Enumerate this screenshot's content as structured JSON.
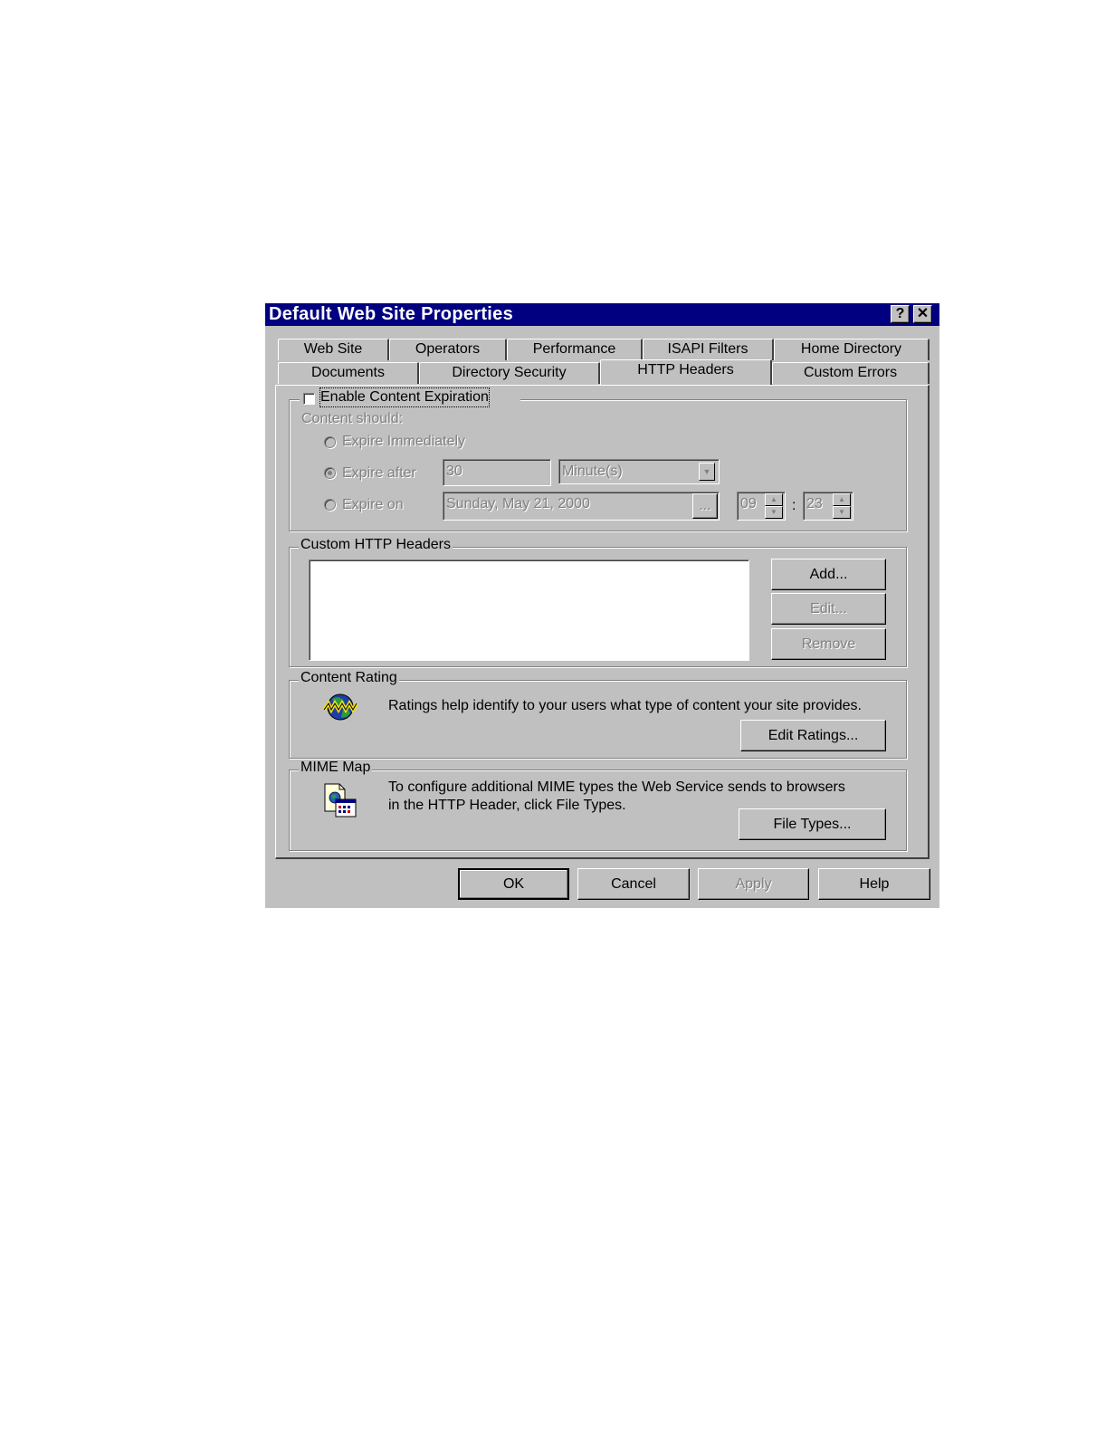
{
  "window": {
    "title": "Default Web Site Properties",
    "help_glyph": "?",
    "close_glyph": "✕"
  },
  "tabs": {
    "row1": [
      "Web Site",
      "Operators",
      "Performance",
      "ISAPI Filters",
      "Home Directory"
    ],
    "row2": [
      "Documents",
      "Directory Security",
      "HTTP Headers",
      "Custom Errors"
    ],
    "active": "HTTP Headers"
  },
  "expiration": {
    "enable_label": "Enable Content Expiration",
    "content_should": "Content should:",
    "expire_immediately": "Expire Immediately",
    "expire_after": "Expire after",
    "expire_after_value": "30",
    "expire_after_unit": "Minute(s)",
    "expire_on": "Expire on",
    "expire_on_date": "Sunday, May 21, 2000",
    "date_button": "...",
    "hour": "09",
    "time_sep": ":",
    "minute": "23"
  },
  "custom_headers": {
    "group_label": "Custom HTTP Headers",
    "add": "Add...",
    "edit": "Edit...",
    "remove": "Remove"
  },
  "content_rating": {
    "group_label": "Content Rating",
    "description": "Ratings help identify to your users what type of content your site provides.",
    "edit_ratings": "Edit Ratings..."
  },
  "mime_map": {
    "group_label": "MIME Map",
    "description_line1": "To configure additional MIME types the Web Service sends to browsers",
    "description_line2": "in the HTTP Header, click File Types.",
    "file_types": "File Types..."
  },
  "footer": {
    "ok": "OK",
    "cancel": "Cancel",
    "apply": "Apply",
    "help": "Help"
  }
}
